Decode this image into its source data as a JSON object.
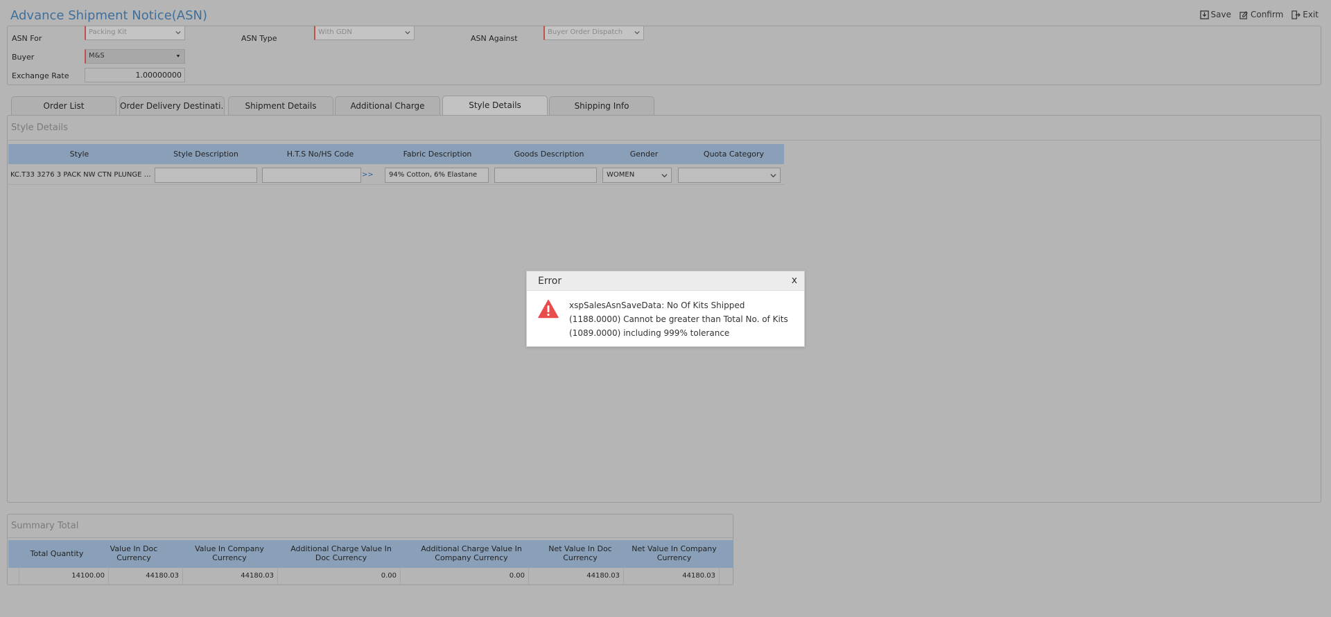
{
  "header": {
    "title": "Advance Shipment Notice(ASN)",
    "toolbar": {
      "save": "Save",
      "confirm": "Confirm",
      "exit": "Exit"
    }
  },
  "form": {
    "asn_for_label": "ASN For",
    "asn_for_value": "Packing Kit",
    "asn_type_label": "ASN Type",
    "asn_type_value": "With GDN",
    "asn_against_label": "ASN Against",
    "asn_against_value": "Buyer Order Dispatch",
    "buyer_label": "Buyer",
    "buyer_value": "M&S",
    "exchange_rate_label": "Exchange Rate",
    "exchange_rate_value": "1.00000000"
  },
  "tabs": [
    "Order List",
    "Order Delivery Destinati...",
    "Shipment Details",
    "Additional Charge",
    "Style Details",
    "Shipping Info"
  ],
  "style_details": {
    "title": "Style Details",
    "columns": [
      "Style",
      "Style Description",
      "H.T.S No/HS Code",
      "Fabric Description",
      "Goods Description",
      "Gender",
      "Quota Category"
    ],
    "row": {
      "style": "KC.T33 3276 3 PACK NW CTN PLUNGE O...",
      "style_description": "",
      "hts_code": "",
      "hts_link": ">>",
      "fabric_description": "94% Cotton, 6% Elastane",
      "goods_description": "",
      "gender": "WOMEN",
      "quota_category": ""
    }
  },
  "summary": {
    "title": "Summary Total",
    "columns": [
      "Total Quantity",
      "Value In Doc Currency",
      "Value In Company Currency",
      "Additional Charge Value In Doc Currency",
      "Additional Charge Value In Company Currency",
      "Net Value In Doc Currency",
      "Net Value In Company Currency"
    ],
    "values": [
      "14100.00",
      "44180.03",
      "44180.03",
      "0.00",
      "0.00",
      "44180.03",
      "44180.03"
    ]
  },
  "dialog": {
    "title": "Error",
    "close": "x",
    "message": "xspSalesAsnSaveData: No Of Kits Shipped (1188.0000) Cannot be greater than Total No. of Kits (1089.0000) including 999% tolerance",
    "icon": "warning-icon",
    "icon_color": "#e84c4c"
  }
}
